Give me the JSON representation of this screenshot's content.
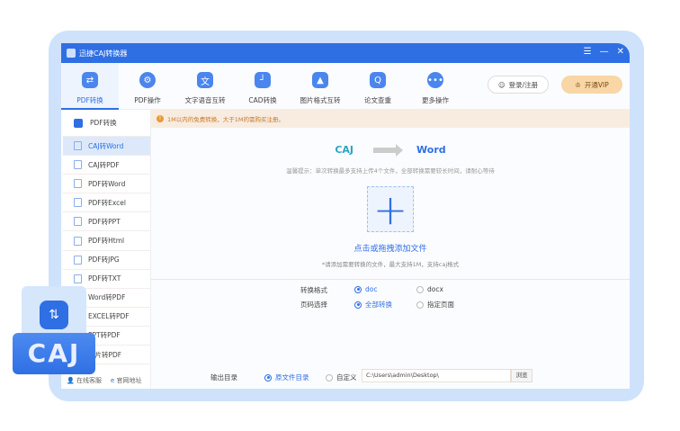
{
  "app": {
    "title": "迅捷CAJ转换器"
  },
  "window_controls": {
    "menu": "☰",
    "minimize": "—",
    "close": "✕"
  },
  "toolbar": {
    "items": [
      {
        "label": "PDF转换",
        "icon": "⇄"
      },
      {
        "label": "PDF操作",
        "icon": "⚙"
      },
      {
        "label": "文字语音互转",
        "icon": "文"
      },
      {
        "label": "CAD转换",
        "icon": "┘"
      },
      {
        "label": "图片格式互转",
        "icon": "▲"
      },
      {
        "label": "论文查重",
        "icon": "Q"
      },
      {
        "label": "更多操作",
        "icon": "•••"
      }
    ],
    "login": "登录/注册",
    "vip": "开通VIP"
  },
  "sidebar": {
    "header": "PDF转换",
    "items": [
      "CAJ转Word",
      "CAJ转PDF",
      "PDF转Word",
      "PDF转Excel",
      "PDF转PPT",
      "PDF转Html",
      "PDF转JPG",
      "PDF转TXT",
      "Word转PDF",
      "EXCEL转PDF",
      "PPT转PDF",
      "图片转PDF"
    ],
    "footer": {
      "service": "在线客服",
      "website": "官网地址"
    }
  },
  "main": {
    "warning": "1M以内的免费转换，大于1M的需购买注册。",
    "from": "CAJ",
    "to": "Word",
    "tip": "温馨提示：单次转换最多支持上传4个文件，全部转换需要较长时间，请耐心等待",
    "add_label": "点击或拖拽添加文件",
    "add_sub": "*请添加需要转换的文件，最大支持1M，支持caj格式",
    "format_label": "转换格式",
    "format_options": [
      "doc",
      "docx"
    ],
    "format_selected": "doc",
    "page_label": "页码选择",
    "page_options": [
      "全部转换",
      "指定页面"
    ],
    "page_selected": "全部转换",
    "output_label": "输出目录",
    "output_options": [
      "原文件目录",
      "自定义"
    ],
    "output_selected": "原文件目录",
    "output_path": "C:\\Users\\admin\\Desktop\\",
    "browse": "浏览"
  },
  "badge": {
    "text": "CAJ"
  }
}
